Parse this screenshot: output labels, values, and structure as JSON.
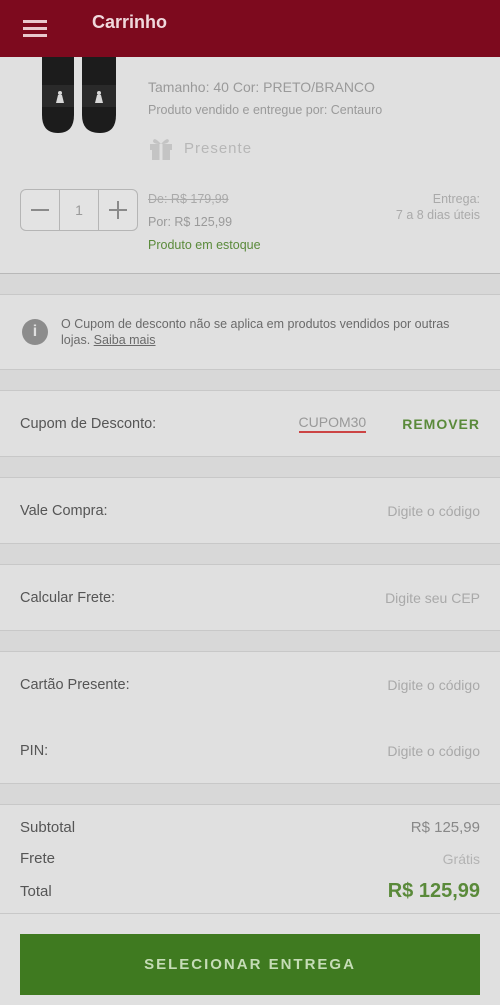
{
  "header": {
    "title": "Carrinho",
    "menu_icon": "hamburger-menu-icon"
  },
  "product": {
    "size_color": "Tamanho: 40   Cor: PRETO/BRANCO",
    "seller": "Produto vendido e entregue por: Centauro",
    "gift_label": "Presente",
    "quantity": "1",
    "price_old": "De: R$ 179,99",
    "price_new": "Por: R$ 125,99",
    "stock": "Produto em estoque",
    "delivery_label": "Entrega:",
    "delivery_time": "7 a 8 dias úteis"
  },
  "notice": {
    "text": "O Cupom de desconto não se aplica em produtos vendidos por outras lojas.",
    "link": "Saiba mais"
  },
  "coupon": {
    "label": "Cupom de Desconto:",
    "code": "CUPOM30",
    "remove": "REMOVER"
  },
  "voucher": {
    "label": "Vale Compra:",
    "placeholder": "Digite o código"
  },
  "shipping": {
    "label": "Calcular Frete:",
    "placeholder": "Digite seu CEP"
  },
  "giftcard": {
    "label": "Cartão Presente:",
    "placeholder": "Digite o código"
  },
  "pin": {
    "label": "PIN:",
    "placeholder": "Digite o código"
  },
  "summary": {
    "subtotal_label": "Subtotal",
    "subtotal_value": "R$ 125,99",
    "frete_label": "Frete",
    "frete_value": "Grátis",
    "total_label": "Total",
    "total_value": "R$ 125,99"
  },
  "cta": {
    "label": "SELECIONAR ENTREGA"
  },
  "colors": {
    "header": "#7d0a1e",
    "accent_green": "#3f7a20",
    "overlay_bg": "#e0e0e0"
  }
}
